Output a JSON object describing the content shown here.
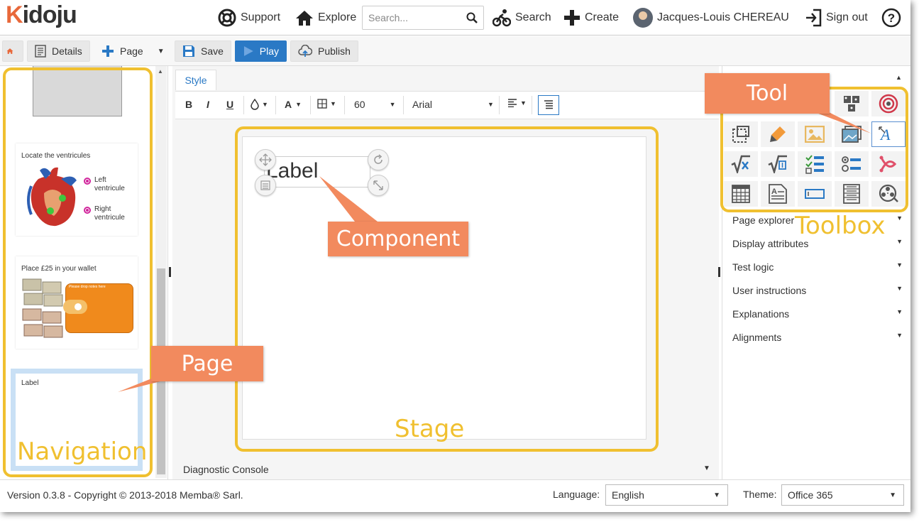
{
  "logo": {
    "text_k": "K",
    "text_rest": "idoju"
  },
  "topnav": {
    "support": "Support",
    "explore": "Explore",
    "search_placeholder": "Search...",
    "search_action": "Search",
    "create": "Create",
    "user": "Jacques-Louis CHEREAU",
    "signout": "Sign out",
    "help": "?"
  },
  "toolbar": {
    "details": "Details",
    "page": "Page",
    "save": "Save",
    "play": "Play",
    "publish": "Publish"
  },
  "navigation": {
    "pages": [
      {
        "title": ""
      },
      {
        "title": "Locate the ventricules",
        "labels": [
          "Left ventricule",
          "Right ventricule"
        ]
      },
      {
        "title": "Place £25 in your wallet",
        "drop": "Please drop notes here"
      },
      {
        "title": "Label"
      }
    ]
  },
  "editor": {
    "style_tab": "Style",
    "font_size": "60",
    "font_family": "Arial",
    "component_text": "Label",
    "diagnostic": "Diagnostic Console"
  },
  "panel": {
    "sections": [
      "Page explorer",
      "Display attributes",
      "Test logic",
      "User instructions",
      "Explanations",
      "Alignments"
    ],
    "tools": [
      "pointer",
      "dice-icon",
      "target-icon",
      "container-icon",
      "highlighter-icon",
      "image-icon",
      "image-set-icon",
      "label-icon",
      "math-icon",
      "math-input-icon",
      "checkboxes-icon",
      "radio-icon",
      "connector-icon",
      "table-icon",
      "text-area-icon",
      "text-box-icon",
      "selector-icon",
      "video-icon"
    ]
  },
  "footer": {
    "version": "Version 0.3.8 - Copyright © 2013-2018 Memba® Sarl.",
    "language_label": "Language:",
    "language_value": "English",
    "theme_label": "Theme:",
    "theme_value": "Office 365"
  },
  "annotations": {
    "tool": "Tool",
    "toolbox": "Toolbox",
    "component": "Component",
    "page": "Page",
    "stage": "Stage",
    "navigation": "Navigation"
  },
  "colors": {
    "accent": "#2a79c5",
    "callout": "#f28a5e",
    "highlight": "#f0c030",
    "logo": "#e8683a"
  }
}
